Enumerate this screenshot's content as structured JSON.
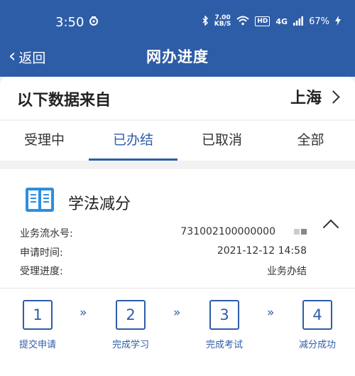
{
  "status_bar": {
    "time": "3:50",
    "speed_value": "7.00",
    "speed_unit": "KB/S",
    "hd": "HD",
    "network": "4G",
    "battery": "67%"
  },
  "nav": {
    "back_label": "返回",
    "title": "网办进度"
  },
  "source": {
    "label": "以下数据来自",
    "region": "上海"
  },
  "tabs": [
    {
      "label": "受理中",
      "active": false
    },
    {
      "label": "已办结",
      "active": true
    },
    {
      "label": "已取消",
      "active": false
    },
    {
      "label": "全部",
      "active": false
    }
  ],
  "card": {
    "service_name": "学法减分",
    "fields": [
      {
        "label": "业务流水号:",
        "value": "731002100000000"
      },
      {
        "label": "申请时间:",
        "value": "2021-12-12 14:58"
      },
      {
        "label": "受理进度:",
        "value": "业务办结"
      }
    ],
    "steps": [
      {
        "number": "1",
        "label": "提交申请"
      },
      {
        "number": "2",
        "label": "完成学习"
      },
      {
        "number": "3",
        "label": "完成考试"
      },
      {
        "number": "4",
        "label": "减分成功"
      }
    ],
    "step_separator": "»"
  },
  "colors": {
    "primary": "#2e5da8",
    "icon_blue": "#2b8fe0"
  }
}
